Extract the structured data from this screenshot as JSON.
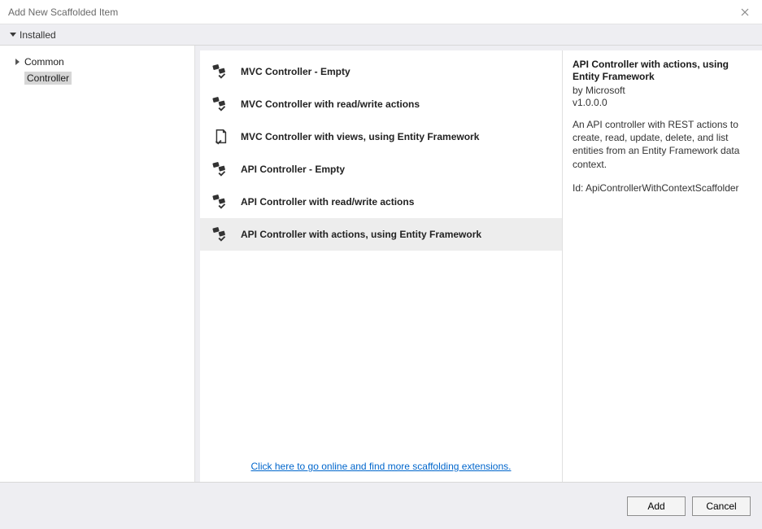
{
  "window": {
    "title": "Add New Scaffolded Item"
  },
  "tabs": {
    "installed": "Installed"
  },
  "sidebar": {
    "items": [
      {
        "label": "Common"
      },
      {
        "label": "Controller"
      }
    ]
  },
  "scaffolds": {
    "items": [
      {
        "label": "MVC Controller - Empty"
      },
      {
        "label": "MVC Controller with read/write actions"
      },
      {
        "label": "MVC Controller with views, using Entity Framework"
      },
      {
        "label": "API Controller - Empty"
      },
      {
        "label": "API Controller with read/write actions"
      },
      {
        "label": "API Controller with actions, using Entity Framework"
      }
    ],
    "online_link": "Click here to go online and find more scaffolding extensions."
  },
  "details": {
    "title": "API Controller with actions, using Entity Framework",
    "by": "by Microsoft",
    "version": "v1.0.0.0",
    "description": "An API controller with REST actions to create, read, update, delete, and list entities from an Entity Framework data context.",
    "id_label": "Id: ApiControllerWithContextScaffolder"
  },
  "footer": {
    "add": "Add",
    "cancel": "Cancel"
  }
}
